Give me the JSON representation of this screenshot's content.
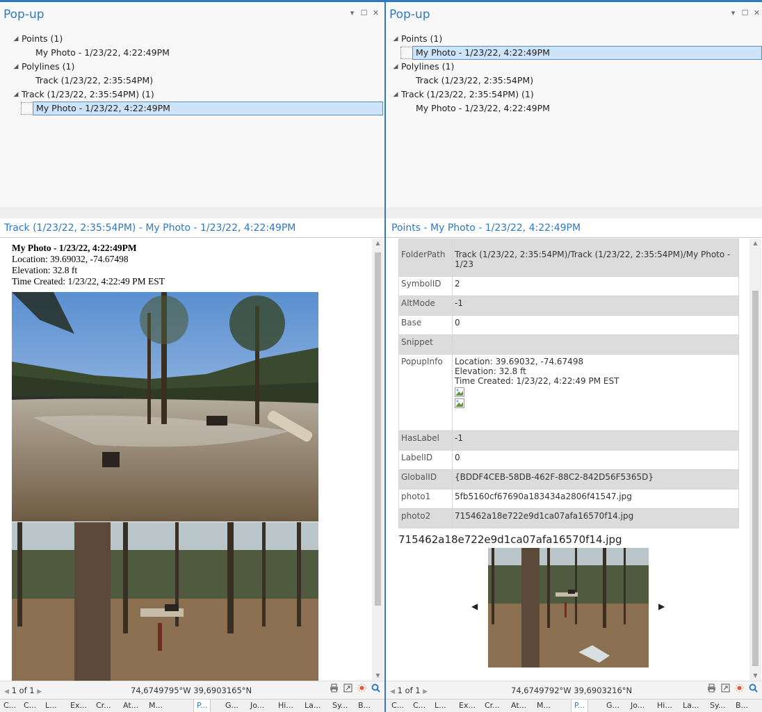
{
  "left": {
    "title": "Pop-up",
    "tree": [
      {
        "label": "Points  (1)",
        "level": 0
      },
      {
        "label": "My Photo - 1/23/22, 4:22:49PM",
        "level": 1
      },
      {
        "label": "Polylines  (1)",
        "level": 0
      },
      {
        "label": "Track (1/23/22, 2:35:54PM)",
        "level": 1
      },
      {
        "label": "Track (1/23/22, 2:35:54PM)  (1)",
        "level": 0
      },
      {
        "label": "My Photo - 1/23/22, 4:22:49PM",
        "level": 1,
        "selected": true
      }
    ],
    "subtitle": "Track (1/23/22, 2:35:54PM) - My Photo - 1/23/22, 4:22:49PM",
    "popup": {
      "heading": "My Photo - 1/23/22, 4:22:49PM",
      "location": "Location: 39.69032, -74.67498",
      "elevation": "Elevation: 32.8 ft",
      "time": "Time Created: 1/23/22, 4:22:49 PM EST"
    },
    "status": {
      "pager": "1 of 1",
      "coords": "74,6749795°W 39,6903165°N"
    }
  },
  "right": {
    "title": "Pop-up",
    "tree": [
      {
        "label": "Points  (1)",
        "level": 0
      },
      {
        "label": "My Photo - 1/23/22, 4:22:49PM",
        "level": 1,
        "selected": true
      },
      {
        "label": "Polylines  (1)",
        "level": 0
      },
      {
        "label": "Track (1/23/22, 2:35:54PM)",
        "level": 1
      },
      {
        "label": "Track (1/23/22, 2:35:54PM)  (1)",
        "level": 0
      },
      {
        "label": "My Photo - 1/23/22, 4:22:49PM",
        "level": 1
      }
    ],
    "subtitle": "Points - My Photo - 1/23/22, 4:22:49PM",
    "attributes": [
      {
        "key": "FolderPath",
        "value": "Track (1/23/22, 2:35:54PM)/Track (1/23/22, 2:35:54PM)/My Photo - 1/23",
        "shade": true
      },
      {
        "key": "SymbolID",
        "value": "2",
        "shade": false
      },
      {
        "key": "AltMode",
        "value": "-1",
        "shade": true
      },
      {
        "key": "Base",
        "value": "0",
        "shade": false
      },
      {
        "key": "Snippet",
        "value": "",
        "shade": true
      },
      {
        "key": "PopupInfo",
        "value": "Location: 39.69032, -74.67498",
        "value2": "Elevation: 32.8 ft",
        "value3": "Time Created: 1/23/22, 4:22:49 PM EST",
        "shade": false,
        "popup": true
      },
      {
        "key": "HasLabel",
        "value": "-1",
        "shade": true
      },
      {
        "key": "LabelID",
        "value": "0",
        "shade": false
      },
      {
        "key": "GlobalID",
        "value": "{BDDF4CEB-58DB-462F-88C2-842D56F5365D}",
        "shade": true
      },
      {
        "key": "photo1",
        "value": "5fb5160cf67690a183434a2806f41547.jpg",
        "shade": false
      },
      {
        "key": "photo2",
        "value": "715462a18e722e9d1ca07afa16570f14.jpg",
        "shade": true
      }
    ],
    "media_caption": "715462a18e722e9d1ca07afa16570f14.jpg",
    "status": {
      "pager": "1 of 1",
      "coords": "74,6749792°W 39,6903216°N"
    }
  },
  "tabs": [
    "C...",
    "C...",
    "L...",
    "Ex...",
    "Cr...",
    "At...",
    "M...",
    "P...",
    "G...",
    "Jo...",
    "Hi...",
    "La...",
    "Sy...",
    "B..."
  ],
  "active_tab": 7,
  "colors": {
    "accent": "#2f79c2",
    "selection": "#cde3f7"
  }
}
